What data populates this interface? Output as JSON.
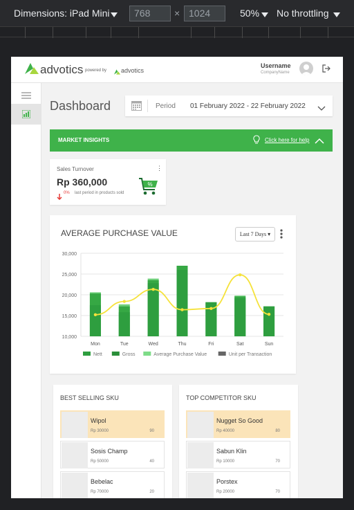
{
  "devtools": {
    "dimensions_label": "Dimensions: iPad Mini",
    "width": "768",
    "height": "1024",
    "times": "×",
    "zoom": "50%",
    "throttling": "No throttling"
  },
  "header": {
    "logo_text": "advotics",
    "powered_by": "powered by",
    "powered_name": "advotics",
    "username": "Username",
    "company": "CompanyName",
    "brand_color": "#3fb24a"
  },
  "page": {
    "title": "Dashboard",
    "period_label": "Period",
    "period_value": "01 February 2022 - 22 February 2022"
  },
  "insights": {
    "title": "MARKET INSIGHTS",
    "help_link": "Click here for help"
  },
  "turnover": {
    "title": "Sales Turnover",
    "value": "Rp 360,000",
    "change": "0%",
    "note": "last period in products sold",
    "change_color": "#e53935"
  },
  "chart_card": {
    "title": "AVERAGE PURCHASE VALUE",
    "range_select": "Last 7 Days"
  },
  "chart_data": {
    "type": "bar",
    "categories": [
      "Mon",
      "Tue",
      "Wed",
      "Thu",
      "Fri",
      "Sat",
      "Sun"
    ],
    "ylim": [
      10000,
      30000
    ],
    "yticks": [
      "10,000",
      "15,000",
      "20,000",
      "25,000",
      "30,000"
    ],
    "ytick_values": [
      10000,
      15000,
      20000,
      25000,
      30000
    ],
    "series": [
      {
        "name": "Nett",
        "values": [
          17500,
          15800,
          22800,
          26000,
          18200,
          19200,
          17200
        ],
        "color": "#2e9e3f"
      },
      {
        "name": "Gross",
        "values": [
          20300,
          17200,
          23500,
          27000,
          18200,
          19600,
          17200
        ],
        "color": "#2e9e3f"
      },
      {
        "name": "Average Purchase Value",
        "values": [
          20600,
          17700,
          23900,
          27000,
          18200,
          19800,
          17200
        ],
        "color": "#6fcf7a"
      },
      {
        "name": "Unit per Transaction",
        "values": [
          15200,
          18400,
          21300,
          16400,
          16700,
          24800,
          15300
        ],
        "color": "#f5e23b"
      }
    ],
    "legend": [
      {
        "name": "Nett",
        "color": "#2e9e3f"
      },
      {
        "name": "Gross",
        "color": "#2a8f39"
      },
      {
        "name": "Average Purchase Value",
        "color": "#7edc88"
      },
      {
        "name": "Unit per Transaction",
        "color": "#666666"
      }
    ],
    "grid": true,
    "legend_placement": "bottom"
  },
  "best_selling": {
    "title": "BEST SELLING SKU",
    "items": [
      {
        "name": "Wipol",
        "price": "Rp 30000",
        "qty": "90",
        "highlight": true
      },
      {
        "name": "Sosis Champ",
        "price": "Rp 50000",
        "qty": "40",
        "highlight": false
      },
      {
        "name": "Bebelac",
        "price": "Rp 70000",
        "qty": "20",
        "highlight": false
      }
    ]
  },
  "competitor": {
    "title": "TOP COMPETITOR SKU",
    "items": [
      {
        "name": "Nugget So Good",
        "price": "Rp 40000",
        "qty": "80",
        "highlight": true
      },
      {
        "name": "Sabun Klin",
        "price": "Rp 10000",
        "qty": "70",
        "highlight": false
      },
      {
        "name": "Porstex",
        "price": "Rp 20000",
        "qty": "70",
        "highlight": false
      }
    ]
  }
}
